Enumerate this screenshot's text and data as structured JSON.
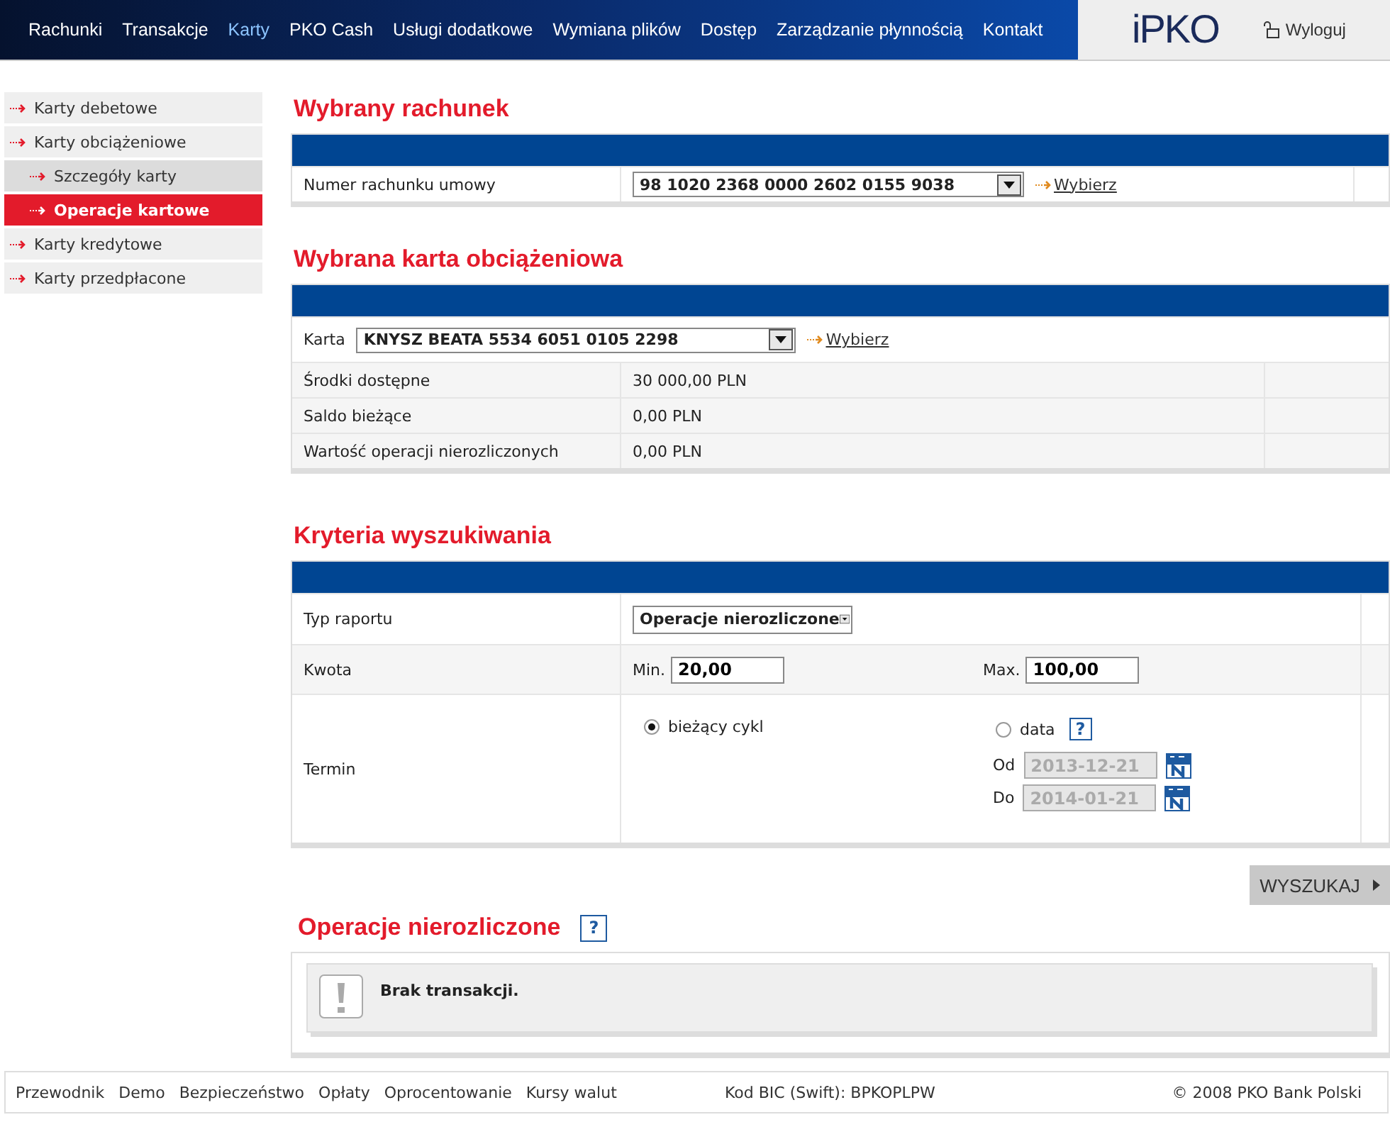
{
  "nav": {
    "items": [
      {
        "label": "Rachunki",
        "selected": false
      },
      {
        "label": "Transakcje",
        "selected": false
      },
      {
        "label": "Karty",
        "selected": true
      },
      {
        "label": "PKO Cash",
        "selected": false
      },
      {
        "label": "Usługi dodatkowe",
        "selected": false
      },
      {
        "label": "Wymiana plików",
        "selected": false
      },
      {
        "label": "Dostęp",
        "selected": false
      },
      {
        "label": "Zarządzanie płynnością",
        "selected": false
      },
      {
        "label": "Kontakt",
        "selected": false
      }
    ],
    "logo": "iPKO",
    "logout": "Wyloguj"
  },
  "sidebar": {
    "items": [
      {
        "label": "Karty debetowe",
        "selected": false
      },
      {
        "label": "Karty obciążeniowe",
        "selected": false,
        "children": [
          {
            "label": "Szczegóły karty",
            "selected": false
          },
          {
            "label": "Operacje kartowe",
            "selected": true
          }
        ]
      },
      {
        "label": "Karty kredytowe",
        "selected": false
      },
      {
        "label": "Karty przedpłacone",
        "selected": false
      }
    ]
  },
  "account": {
    "title": "Wybrany rachunek",
    "label": "Numer rachunku umowy",
    "value": "98 1020 2368 0000 2602 0155 9038",
    "link": "Wybierz"
  },
  "card": {
    "title": "Wybrana karta obciążeniowa",
    "label": "Karta",
    "value": "KNYSZ BEATA 5534 6051 0105 2298",
    "link": "Wybierz",
    "rows": [
      {
        "label": "Środki dostępne",
        "value": "30 000,00 PLN"
      },
      {
        "label": "Saldo bieżące",
        "value": "0,00 PLN"
      },
      {
        "label": "Wartość operacji nierozliczonych",
        "value": "0,00 PLN"
      }
    ]
  },
  "criteria": {
    "title": "Kryteria wyszukiwania",
    "report_type": {
      "label": "Typ raportu",
      "value": "Operacje nierozliczone"
    },
    "amount": {
      "label": "Kwota",
      "min_label": "Min.",
      "min": "20,00",
      "max_label": "Max.",
      "max": "100,00"
    },
    "term": {
      "label": "Termin",
      "options": [
        {
          "label": "bieżący cykl",
          "selected": true
        },
        {
          "label": "data",
          "selected": false
        }
      ],
      "help": "?",
      "from_label": "Od",
      "from": "2013-12-21",
      "to_label": "Do",
      "to": "2014-01-21",
      "dates_disabled": true
    },
    "search_button": "WYSZUKAJ"
  },
  "results": {
    "title": "Operacje nierozliczone",
    "help": "?",
    "message": "Brak transakcji."
  },
  "footer": {
    "links": [
      "Przewodnik",
      "Demo",
      "Bezpieczeństwo",
      "Opłaty",
      "Oprocentowanie",
      "Kursy walut"
    ],
    "bic": "Kod BIC (Swift): BPKOPLPW",
    "copyright": "© 2008 PKO Bank Polski"
  }
}
